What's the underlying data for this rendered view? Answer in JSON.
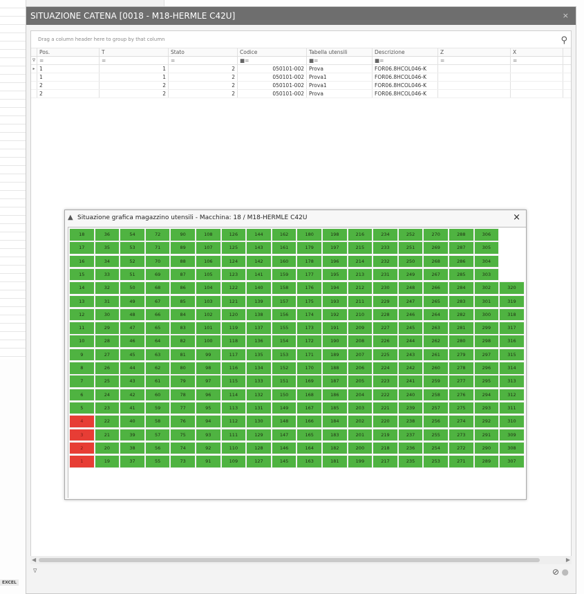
{
  "window": {
    "title": "SITUAZIONE CATENA [0018 - M18-HERMLE C42U]",
    "close_label": "×"
  },
  "grid": {
    "group_hint": "Drag a column header here to group by that column",
    "columns": [
      "Pos.",
      "T",
      "Stato",
      "Codice",
      "Tabella utensili",
      "Descrizione",
      "Z",
      "X"
    ],
    "filters": [
      "=",
      "=",
      "=",
      "■=",
      "■=",
      "■=",
      "=",
      "="
    ],
    "rows": [
      [
        "1",
        "1",
        "2",
        "050101-002",
        "Prova",
        "FOR06.8HCOL046-K",
        "",
        ""
      ],
      [
        "1",
        "1",
        "2",
        "050101-002",
        "Prova1",
        "FOR06.8HCOL046-K",
        "",
        ""
      ],
      [
        "2",
        "2",
        "2",
        "050101-002",
        "Prova1",
        "FOR06.8HCOL046-K",
        "",
        ""
      ],
      [
        "2",
        "2",
        "2",
        "050101-002",
        "Prova",
        "FOR06.8HCOL046-K",
        "",
        ""
      ]
    ]
  },
  "status": {
    "left_text": "∇"
  },
  "excel_label": "EXCEL",
  "magazine": {
    "title": "Situazione grafica magazzino utensili - Macchina: 18 / M18-HERMLE C42U",
    "close_label": "×",
    "columns": 18,
    "rows_per_column": 18,
    "last_slot": 320,
    "red_slots": [
      1,
      2,
      3,
      4
    ],
    "colors": {
      "ok": "#4fb341",
      "bad": "#e73d35"
    }
  }
}
